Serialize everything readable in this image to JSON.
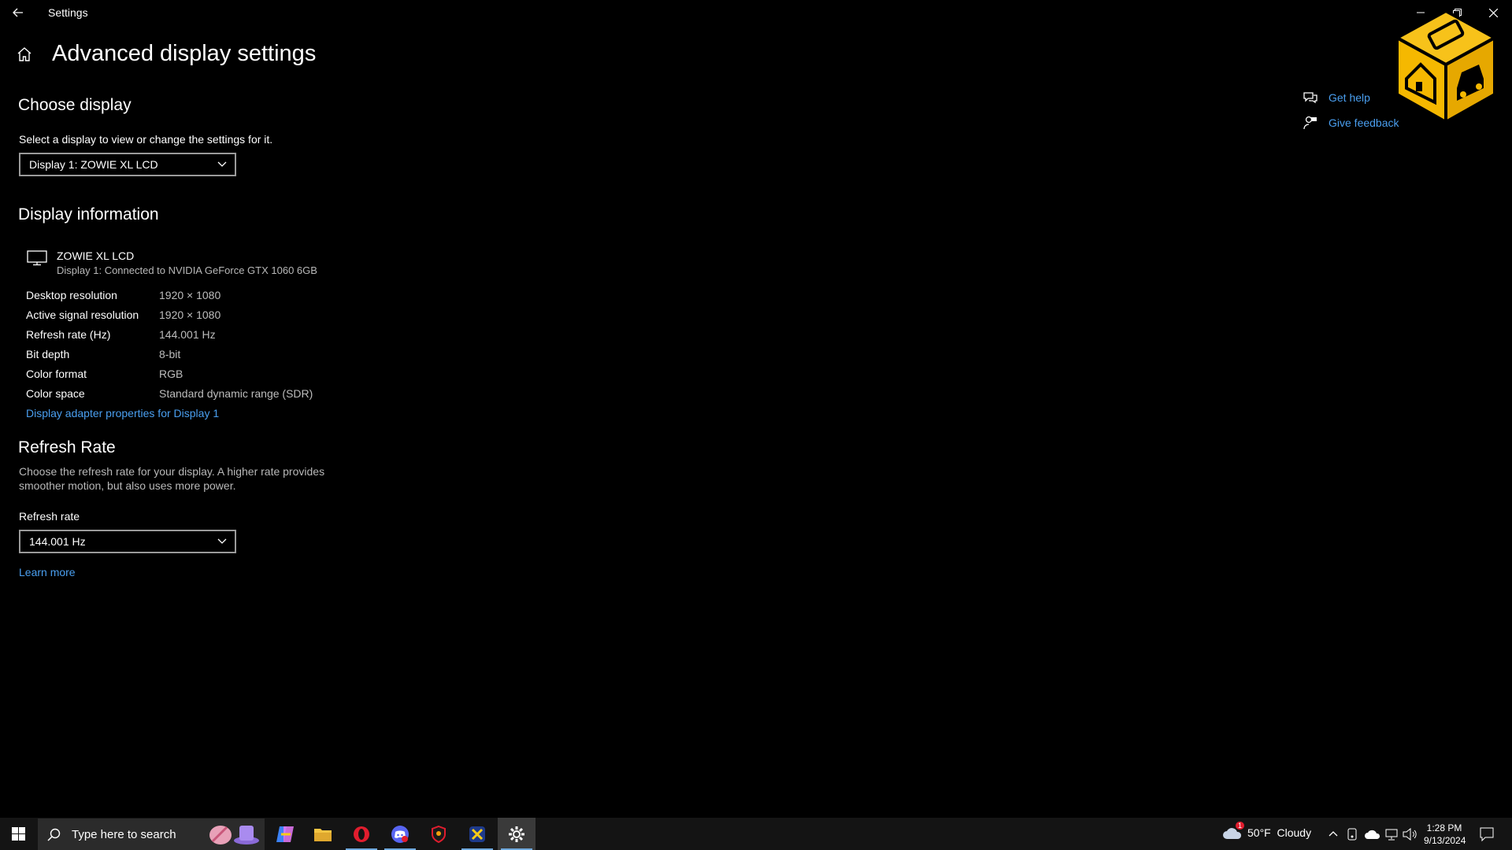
{
  "window": {
    "title": "Settings"
  },
  "page": {
    "title": "Advanced display settings"
  },
  "choose_display": {
    "heading": "Choose display",
    "description": "Select a display to view or change the settings for it.",
    "selected": "Display 1: ZOWIE XL LCD"
  },
  "display_info": {
    "heading": "Display information",
    "monitor_name": "ZOWIE XL LCD",
    "monitor_connection": "Display 1: Connected to NVIDIA GeForce GTX 1060 6GB",
    "rows": [
      {
        "label": "Desktop resolution",
        "value": "1920 × 1080"
      },
      {
        "label": "Active signal resolution",
        "value": "1920 × 1080"
      },
      {
        "label": "Refresh rate (Hz)",
        "value": "144.001 Hz"
      },
      {
        "label": "Bit depth",
        "value": "8-bit"
      },
      {
        "label": "Color format",
        "value": "RGB"
      },
      {
        "label": "Color space",
        "value": "Standard dynamic range (SDR)"
      }
    ],
    "adapter_link": "Display adapter properties for Display 1"
  },
  "refresh_rate": {
    "heading": "Refresh Rate",
    "description_line1": "Choose the refresh rate for your display. A higher rate provides",
    "description_line2": "smoother motion, but also uses more power.",
    "label": "Refresh rate",
    "selected": "144.001 Hz",
    "learn_more": "Learn more"
  },
  "help": {
    "get_help": "Get help",
    "give_feedback": "Give feedback"
  },
  "taskbar": {
    "search_placeholder": "Type here to search",
    "weather": "50°F  Cloudy",
    "weather_badge": "1",
    "time": "1:28 PM",
    "date": "9/13/2024"
  },
  "colors": {
    "accent_link": "#4a9ff0",
    "background": "#000000",
    "logo_yellow": "#f5b800"
  }
}
